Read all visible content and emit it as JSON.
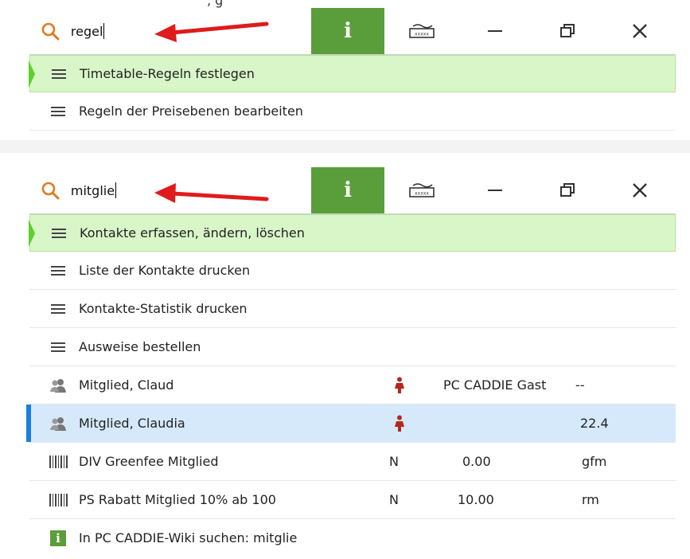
{
  "accent_green": "#5a9e3c",
  "selection_green": "#d8f6c8",
  "selection_blue": "#d6e9fb",
  "panel1": {
    "search_value": "regel",
    "items": [
      {
        "icon": "menu-icon",
        "label": "Timetable-Regeln festlegen",
        "selected": true
      },
      {
        "icon": "menu-icon",
        "label": "Regeln der Preisebenen bearbeiten",
        "selected": false
      }
    ]
  },
  "panel2": {
    "search_value": "mitglie",
    "menu_items": [
      {
        "icon": "menu-icon",
        "label": "Kontakte erfassen, ändern, löschen"
      },
      {
        "icon": "menu-icon",
        "label": "Liste der Kontakte drucken"
      },
      {
        "icon": "menu-icon",
        "label": "Kontakte-Statistik drucken"
      },
      {
        "icon": "menu-icon",
        "label": "Ausweise bestellen"
      }
    ],
    "contacts": [
      {
        "icon": "contact-icon",
        "label": "Mitglied, Claud",
        "gender_icon": "female-person-icon",
        "status": "PC CADDIE Gast",
        "value": "--"
      },
      {
        "icon": "contact-icon",
        "label": "Mitglied, Claudia",
        "gender_icon": "female-person-icon",
        "status": "",
        "value": "22.4"
      }
    ],
    "articles": [
      {
        "icon": "barcode-icon",
        "label": "DIV Greenfee Mitglied",
        "flag": "N",
        "price": "0.00",
        "code": "gfm"
      },
      {
        "icon": "barcode-icon",
        "label": "PS Rabatt Mitglied 10% ab 100",
        "flag": "N",
        "price": "10.00",
        "code": "rm"
      }
    ],
    "wiki_item": {
      "icon": "info-icon",
      "label": "In PC CADDIE-Wiki suchen: mitglie"
    }
  },
  "info_button_label": "i"
}
